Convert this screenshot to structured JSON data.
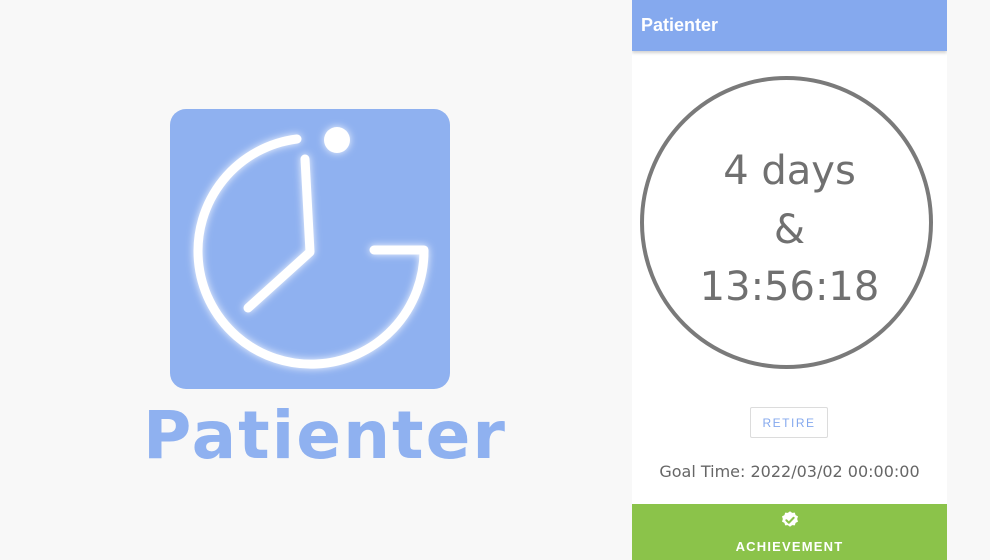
{
  "promo": {
    "brand_name": "Patienter",
    "logo_icon": "clock-logo-icon",
    "brand_color": "#8fb1f0"
  },
  "app": {
    "title": "Patienter",
    "app_bar_color": "#85a9ee",
    "timer": {
      "days_text": "4 days",
      "separator": "&",
      "clock_text": "13:56:18"
    },
    "retire_button": {
      "label": "RETIRE"
    },
    "goal_time": "Goal Time: 2022/03/02 00:00:00",
    "achievement": {
      "label": "ACHIEVEMENT",
      "icon": "verified-check-icon",
      "color": "#8bc34a"
    }
  }
}
